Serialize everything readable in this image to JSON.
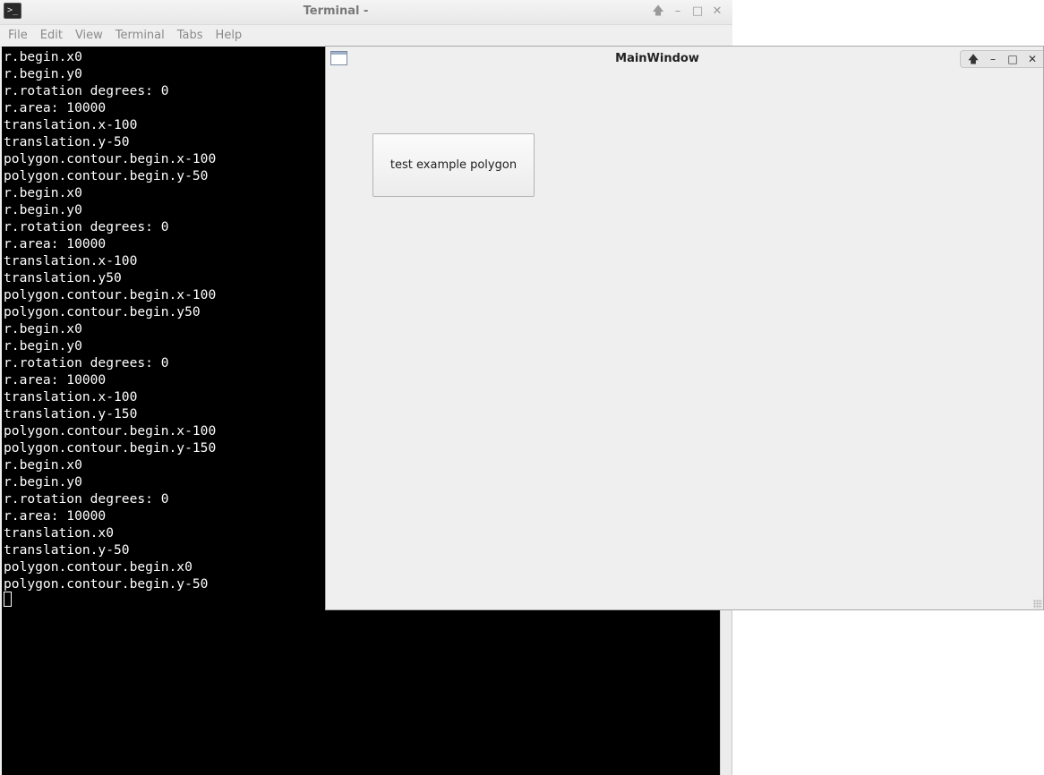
{
  "terminal": {
    "title": "Terminal -",
    "icon": "terminal-icon",
    "icon_glyph": ">_",
    "controls": {
      "keep_above": "🡅",
      "minimize": "–",
      "maximize": "□",
      "close": "✕"
    },
    "menu": [
      "File",
      "Edit",
      "View",
      "Terminal",
      "Tabs",
      "Help"
    ],
    "lines": [
      "r.begin.x0",
      "r.begin.y0",
      "r.rotation degrees: 0",
      "r.area: 10000",
      "translation.x-100",
      "translation.y-50",
      "polygon.contour.begin.x-100",
      "polygon.contour.begin.y-50",
      "r.begin.x0",
      "r.begin.y0",
      "r.rotation degrees: 0",
      "r.area: 10000",
      "translation.x-100",
      "translation.y50",
      "polygon.contour.begin.x-100",
      "polygon.contour.begin.y50",
      "r.begin.x0",
      "r.begin.y0",
      "r.rotation degrees: 0",
      "r.area: 10000",
      "translation.x-100",
      "translation.y-150",
      "polygon.contour.begin.x-100",
      "polygon.contour.begin.y-150",
      "r.begin.x0",
      "r.begin.y0",
      "r.rotation degrees: 0",
      "r.area: 10000",
      "translation.x0",
      "translation.y-50",
      "polygon.contour.begin.x0",
      "polygon.contour.begin.y-50"
    ]
  },
  "main_window": {
    "title": "MainWindow",
    "icon": "window-icon",
    "controls": {
      "keep_above": "🡅",
      "minimize": "–",
      "maximize": "□",
      "close": "✕"
    },
    "button_label": "test example polygon"
  },
  "colors": {
    "terminal_bg": "#000000",
    "terminal_fg": "#ffffff",
    "window_bg": "#efefef"
  }
}
